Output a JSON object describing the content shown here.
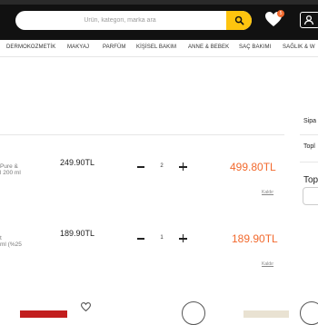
{
  "header": {
    "search_placeholder": "Ürün, kategori, marka ara",
    "favorites_count": "5"
  },
  "nav": {
    "items": [
      "DERMOKOZMETİK",
      "MAKYAJ",
      "PARFÜM",
      "KİŞİSEL BAKIM",
      "ANNE & BEBEK",
      "SAÇ BAKIMI",
      "SAĞLIK & W"
    ]
  },
  "cart": {
    "items": [
      {
        "name_line1": "Pure &",
        "name_line2": "l 200 ml",
        "unit_price": "249.90TL",
        "quantity": "2",
        "total": "499.80TL",
        "remove_label": "Kaldır"
      },
      {
        "name_line1": "t",
        "name_line2": "ml (%25",
        "unit_price": "189.90TL",
        "quantity": "1",
        "total": "189.90TL",
        "remove_label": "Kaldır"
      }
    ]
  },
  "summary": {
    "tab": "Sipa",
    "line1": "Topl",
    "line2": "Top"
  },
  "colors": {
    "header_bg": "#111111",
    "accent_yellow": "#fec40f",
    "price_orange": "#f26a2e"
  }
}
